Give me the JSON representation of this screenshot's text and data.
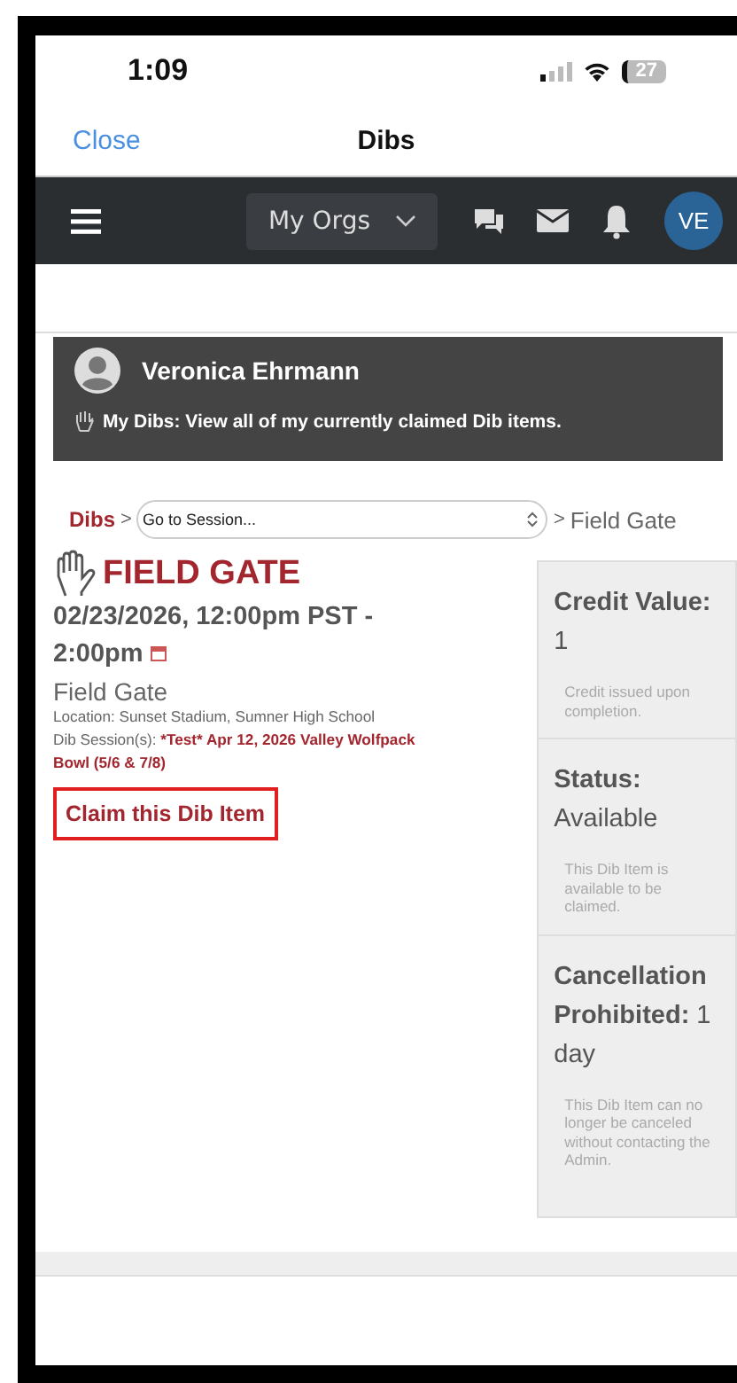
{
  "status_bar": {
    "time": "1:09",
    "battery": "27"
  },
  "nav_bar": {
    "close": "Close",
    "title": "Dibs"
  },
  "header": {
    "orgs_dropdown": "My Orgs",
    "avatar": "VE"
  },
  "profile": {
    "name": "Veronica Ehrmann",
    "note": "My Dibs: View all of my currently claimed Dib items."
  },
  "breadcrumb": {
    "root": "Dibs",
    "separator_1": ">",
    "session_select": "Go to Session...",
    "separator_2": ">",
    "current": "Field Gate"
  },
  "item": {
    "title": "FIELD GATE",
    "datetime": "02/23/2026, 12:00pm PST - 2:00pm",
    "subtitle": "Field Gate",
    "location": "Location: Sunset Stadium, Sumner High School",
    "session_label": "Dib Session(s):",
    "session": "*Test* Apr 12, 2026 Valley Wolfpack Bowl (5/6 & 7/8)",
    "claim_button": "Claim this Dib Item"
  },
  "side_panels": [
    {
      "label": "Credit Value:",
      "value": "1",
      "note": "Credit issued upon completion."
    },
    {
      "label": "Status:",
      "value": "Available",
      "note": "This Dib Item is available to be claimed."
    },
    {
      "label": "Cancellation Prohibited:",
      "value": "1 day",
      "note": "This Dib Item can no longer be canceled without contacting the Admin."
    }
  ]
}
